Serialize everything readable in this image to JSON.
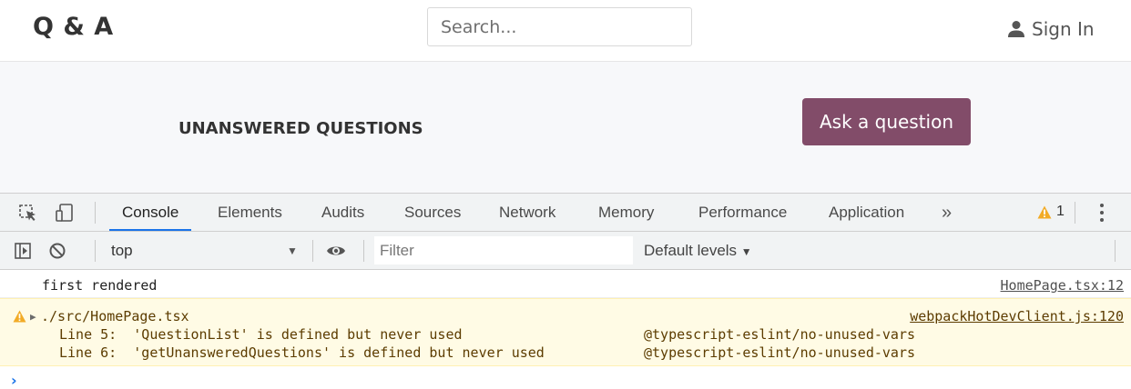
{
  "app": {
    "brand": "Q & A",
    "search_placeholder": "Search...",
    "sign_in": "Sign In"
  },
  "page": {
    "title": "UNANSWERED QUESTIONS",
    "ask_button": "Ask a question"
  },
  "devtools": {
    "tabs": [
      "Console",
      "Elements",
      "Audits",
      "Sources",
      "Network",
      "Memory",
      "Performance",
      "Application"
    ],
    "active_tab": "Console",
    "more_tabs": "»",
    "warning_count": "1",
    "context": "top",
    "filter_placeholder": "Filter",
    "levels": "Default levels",
    "messages": [
      {
        "type": "log",
        "text": "first rendered",
        "source": "HomePage.tsx:12"
      },
      {
        "type": "warning",
        "file": "./src/HomePage.tsx",
        "source": "webpackHotDevClient.js:120",
        "lines": [
          {
            "text": "Line 5:  'QuestionList' is defined but never used",
            "rule": "@typescript-eslint/no-unused-vars"
          },
          {
            "text": "Line 6:  'getUnansweredQuestions' is defined but never used",
            "rule": "@typescript-eslint/no-unused-vars"
          }
        ]
      }
    ],
    "prompt": "›"
  },
  "colors": {
    "accent": "#824c69",
    "devtools_blue": "#1a73e8",
    "warning_bg": "#fffbe5",
    "warning_icon": "#f2ab26"
  }
}
